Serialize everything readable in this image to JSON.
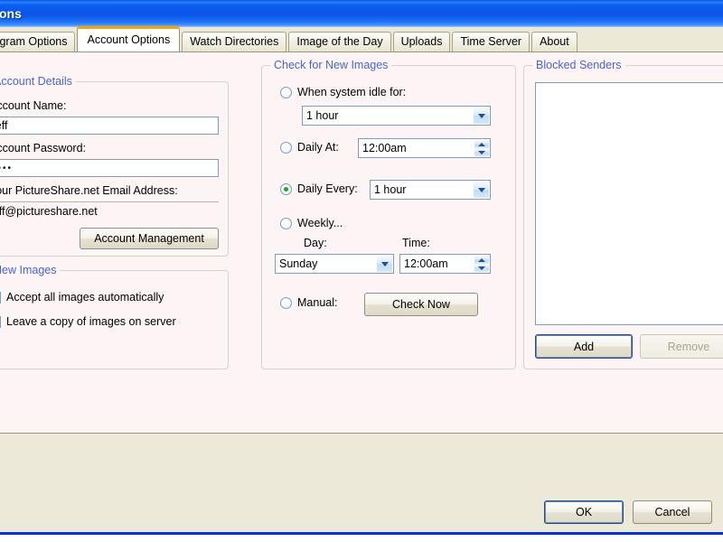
{
  "window": {
    "title": "Options"
  },
  "tabs": [
    {
      "label": "Program Options",
      "active": false
    },
    {
      "label": "Account Options",
      "active": true
    },
    {
      "label": "Watch Directories",
      "active": false
    },
    {
      "label": "Image of the Day",
      "active": false
    },
    {
      "label": "Uploads",
      "active": false
    },
    {
      "label": "Time Server",
      "active": false
    },
    {
      "label": "About",
      "active": false
    }
  ],
  "account_details": {
    "group_title": "Account Details",
    "account_name_label": "Account Name:",
    "account_name_value": "jeff",
    "account_password_label": "Account Password:",
    "account_password_value": "••••",
    "email_label": "Your PictureShare.net Email Address:",
    "email_value": "jeff@pictureshare.net",
    "account_management_button": "Account Management"
  },
  "new_images": {
    "group_title": "New Images",
    "accept_all_label": "Accept all images automatically",
    "accept_all_checked": false,
    "leave_copy_label": "Leave a copy of images on server",
    "leave_copy_checked": true
  },
  "check_for_new_images": {
    "group_title": "Check for New Images",
    "when_idle_label": "When system idle for:",
    "when_idle_selected": false,
    "when_idle_value": "1 hour",
    "daily_at_label": "Daily At:",
    "daily_at_selected": false,
    "daily_at_value": "12:00am",
    "daily_every_label": "Daily Every:",
    "daily_every_selected": true,
    "daily_every_value": "1 hour",
    "weekly_label": "Weekly...",
    "weekly_selected": false,
    "weekly_day_label": "Day:",
    "weekly_day_value": "Sunday",
    "weekly_time_label": "Time:",
    "weekly_time_value": "12:00am",
    "manual_label": "Manual:",
    "manual_selected": false,
    "check_now_button": "Check Now"
  },
  "blocked_senders": {
    "group_title": "Blocked Senders",
    "items": [],
    "add_button": "Add",
    "remove_button": "Remove",
    "remove_enabled": false
  },
  "footer": {
    "ok_button": "OK",
    "cancel_button": "Cancel"
  },
  "colors": {
    "titlebar_blue": "#0a55e8",
    "dialog_face": "#ece9d8",
    "tabpage_bg": "#fdf5f5",
    "group_label_blue": "#4a62d5",
    "active_tab_accent": "#f0a500",
    "check_green": "#23a127",
    "border_blue": "#0831d9"
  }
}
